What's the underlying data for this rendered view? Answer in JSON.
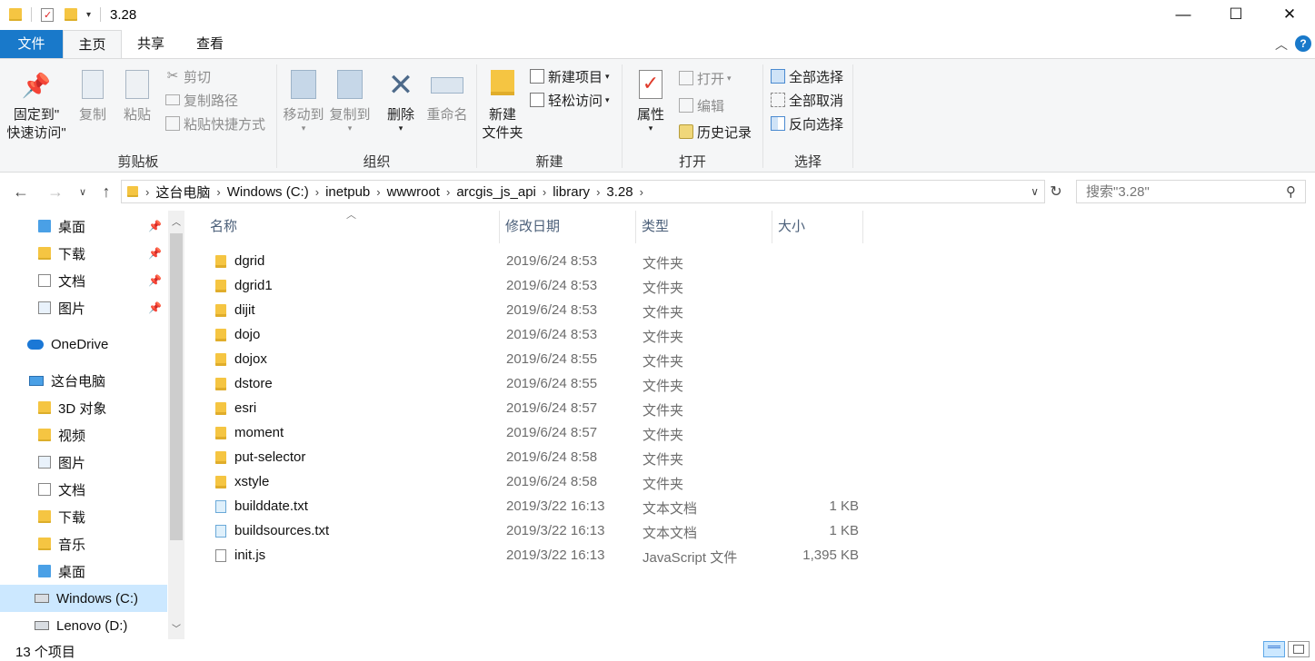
{
  "window": {
    "title": "3.28",
    "controls": {
      "minimize": "—",
      "maximize": "☐",
      "close": "✕"
    }
  },
  "ribbon_tabs": [
    "文件",
    "主页",
    "共享",
    "查看"
  ],
  "ribbon": {
    "clipboard": {
      "group_label": "剪贴板",
      "pin_label_1": "固定到\"",
      "pin_label_2": "快速访问\"",
      "copy": "复制",
      "paste": "粘贴",
      "cut": "剪切",
      "copy_path": "复制路径",
      "paste_shortcut": "粘贴快捷方式"
    },
    "organize": {
      "group_label": "组织",
      "move_to": "移动到",
      "copy_to": "复制到",
      "delete": "删除",
      "rename": "重命名"
    },
    "new": {
      "group_label": "新建",
      "new_folder_1": "新建",
      "new_folder_2": "文件夹",
      "new_item": "新建项目",
      "easy_access": "轻松访问"
    },
    "open": {
      "group_label": "打开",
      "properties": "属性",
      "open": "打开",
      "edit": "编辑",
      "history": "历史记录"
    },
    "select": {
      "group_label": "选择",
      "select_all": "全部选择",
      "select_none": "全部取消",
      "invert": "反向选择"
    }
  },
  "breadcrumb": [
    "这台电脑",
    "Windows (C:)",
    "inetpub",
    "wwwroot",
    "arcgis_js_api",
    "library",
    "3.28"
  ],
  "search": {
    "placeholder": "搜索\"3.28\""
  },
  "nav_pane": {
    "items": [
      {
        "label": "桌面",
        "pinned": true
      },
      {
        "label": "下载",
        "pinned": true
      },
      {
        "label": "文档",
        "pinned": true
      },
      {
        "label": "图片",
        "pinned": true
      },
      {
        "label": "OneDrive"
      },
      {
        "label": "这台电脑"
      },
      {
        "label": "3D 对象"
      },
      {
        "label": "视频"
      },
      {
        "label": "图片"
      },
      {
        "label": "文档"
      },
      {
        "label": "下载"
      },
      {
        "label": "音乐"
      },
      {
        "label": "桌面"
      },
      {
        "label": "Windows (C:)",
        "selected": true
      },
      {
        "label": "Lenovo (D:)"
      }
    ]
  },
  "columns": {
    "name": "名称",
    "date": "修改日期",
    "type": "类型",
    "size": "大小"
  },
  "files": [
    {
      "name": "dgrid",
      "date": "2019/6/24 8:53",
      "type": "文件夹",
      "size": "",
      "icon": "folder-icon"
    },
    {
      "name": "dgrid1",
      "date": "2019/6/24 8:53",
      "type": "文件夹",
      "size": "",
      "icon": "folder-icon"
    },
    {
      "name": "dijit",
      "date": "2019/6/24 8:53",
      "type": "文件夹",
      "size": "",
      "icon": "folder-icon"
    },
    {
      "name": "dojo",
      "date": "2019/6/24 8:53",
      "type": "文件夹",
      "size": "",
      "icon": "folder-icon"
    },
    {
      "name": "dojox",
      "date": "2019/6/24 8:55",
      "type": "文件夹",
      "size": "",
      "icon": "folder-icon"
    },
    {
      "name": "dstore",
      "date": "2019/6/24 8:55",
      "type": "文件夹",
      "size": "",
      "icon": "folder-icon"
    },
    {
      "name": "esri",
      "date": "2019/6/24 8:57",
      "type": "文件夹",
      "size": "",
      "icon": "folder-icon"
    },
    {
      "name": "moment",
      "date": "2019/6/24 8:57",
      "type": "文件夹",
      "size": "",
      "icon": "folder-icon"
    },
    {
      "name": "put-selector",
      "date": "2019/6/24 8:58",
      "type": "文件夹",
      "size": "",
      "icon": "folder-icon"
    },
    {
      "name": "xstyle",
      "date": "2019/6/24 8:58",
      "type": "文件夹",
      "size": "",
      "icon": "folder-icon"
    },
    {
      "name": "builddate.txt",
      "date": "2019/3/22 16:13",
      "type": "文本文档",
      "size": "1 KB",
      "icon": "text-file-icon"
    },
    {
      "name": "buildsources.txt",
      "date": "2019/3/22 16:13",
      "type": "文本文档",
      "size": "1 KB",
      "icon": "text-file-icon"
    },
    {
      "name": "init.js",
      "date": "2019/3/22 16:13",
      "type": "JavaScript 文件",
      "size": "1,395 KB",
      "icon": "js-file-icon"
    }
  ],
  "status": {
    "item_count": "13 个项目"
  },
  "colors": {
    "file_tab": "#1979ca",
    "ribbon_bg": "#f5f6f7",
    "selection": "#cce8ff",
    "header_text": "#4c607a"
  }
}
